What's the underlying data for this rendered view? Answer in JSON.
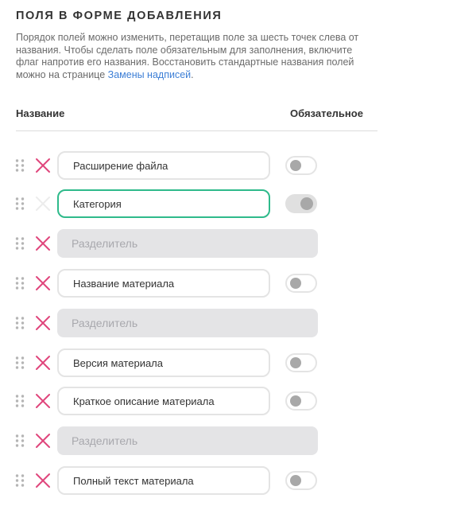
{
  "section": {
    "title": "ПОЛЯ В ФОРМЕ ДОБАВЛЕНИЯ",
    "description_text": "Порядок полей можно изменить, перетащив поле за шесть точек слева от названия. Чтобы сделать поле обязательным для заполнения, включите флаг напротив его названия. Восстановить стандартные названия полей можно на странице ",
    "description_link": "Замены надписей",
    "description_end": "."
  },
  "columns": {
    "name": "Название",
    "required": "Обязательное"
  },
  "fields": [
    {
      "type": "field",
      "value": "Расширение файла",
      "deletable": true,
      "required": false,
      "active": false
    },
    {
      "type": "field",
      "value": "Категория",
      "deletable": false,
      "required": true,
      "active": true
    },
    {
      "type": "separator",
      "value": "Разделитель",
      "deletable": true
    },
    {
      "type": "field",
      "value": "Название материала",
      "deletable": true,
      "required": false,
      "active": false
    },
    {
      "type": "separator",
      "value": "Разделитель",
      "deletable": true
    },
    {
      "type": "field",
      "value": "Версия материала",
      "deletable": true,
      "required": false,
      "active": false
    },
    {
      "type": "field",
      "value": "Краткое описание материала",
      "deletable": true,
      "required": false,
      "active": false
    },
    {
      "type": "separator",
      "value": "Разделитель",
      "deletable": true
    },
    {
      "type": "field",
      "value": "Полный текст материала",
      "deletable": true,
      "required": false,
      "active": false
    }
  ],
  "colors": {
    "delete_active": "#e0467c",
    "delete_disabled": "#ececec",
    "active_border": "#2fba8b",
    "link": "#3d7fd6",
    "grip": "#b5b5b5"
  },
  "icons": {
    "grip": "drag-handle-icon",
    "delete": "close-icon"
  }
}
